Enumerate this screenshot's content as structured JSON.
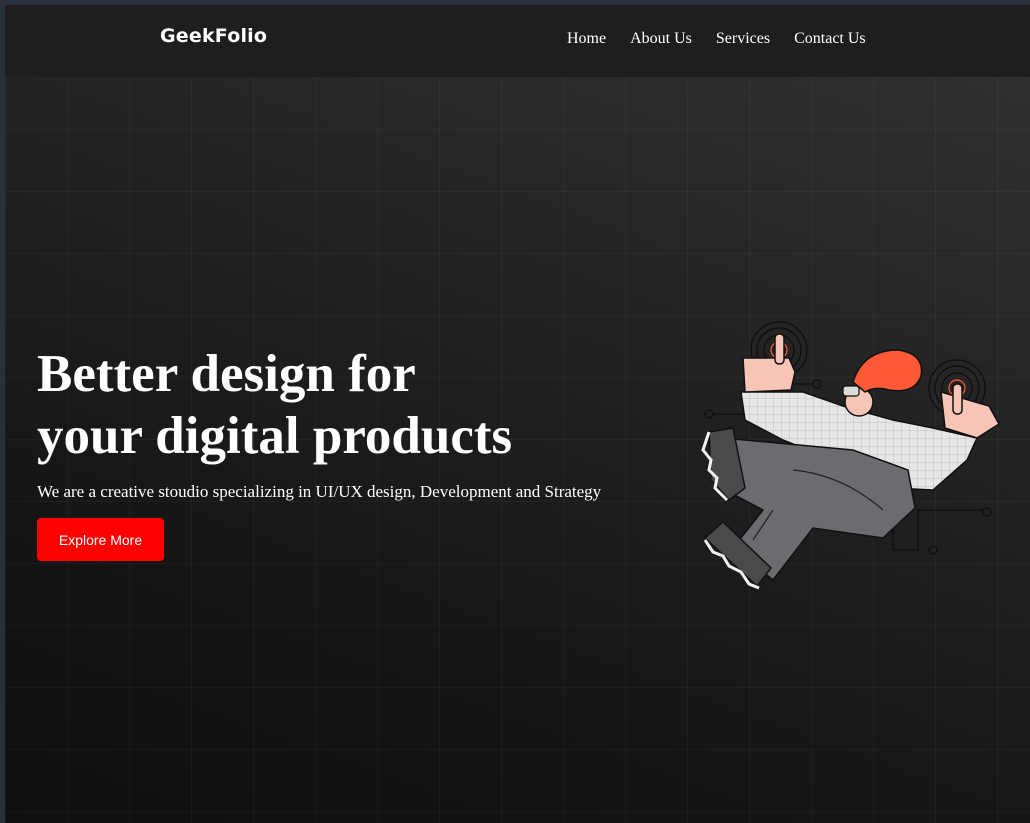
{
  "header": {
    "logo": "GeekFolio",
    "nav": [
      {
        "label": "Home"
      },
      {
        "label": "About Us"
      },
      {
        "label": "Services"
      },
      {
        "label": "Contact Us"
      }
    ]
  },
  "hero": {
    "title_line1": "Better design for",
    "title_line2": "your digital products",
    "subtitle": "We are a creative stoudio specializing in UI/UX design, Development and Strategy",
    "cta_label": "Explore More"
  },
  "colors": {
    "accent": "#ff0000",
    "header_bg": "#1f1e1e",
    "text": "#ffffff",
    "illustration_accent": "#ff5a36"
  },
  "icons": [
    "floating-person-illustration"
  ]
}
